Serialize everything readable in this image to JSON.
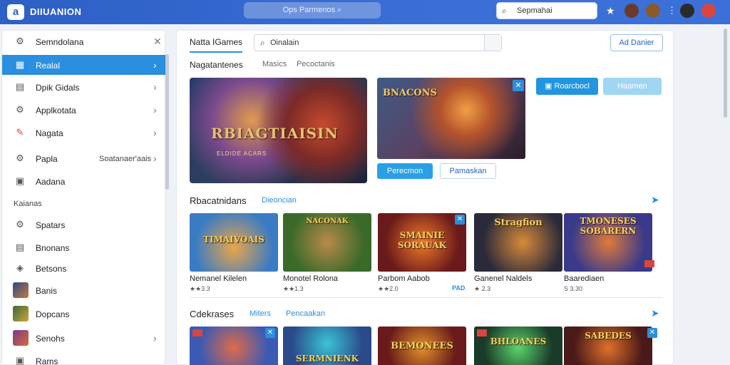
{
  "topbar": {
    "logo_letter": "a",
    "brand": "DIIUANION",
    "search_placeholder": "Ops Parmenos",
    "search2_text": "Sepmahai",
    "avatar_colors": [
      "#6b3a2a",
      "#8a5a2a",
      "#2b2b2b",
      "#c93b2f"
    ]
  },
  "sidebar": {
    "items": [
      {
        "icon": "gear-icon",
        "label": "Semndolana",
        "chevron": "✕"
      },
      {
        "icon": "calendar-icon",
        "label": "Realal",
        "chevron": "›",
        "active": true
      },
      {
        "icon": "document-icon",
        "label": "Dpik Gidals",
        "chevron": "›"
      },
      {
        "icon": "gear-icon",
        "label": "Applkotata",
        "chevron": "›"
      },
      {
        "icon": "pencil-icon",
        "label": "Nagata",
        "chevron": "›"
      },
      {
        "icon": "gear-icon",
        "label": "Papla",
        "extra": "Soatanaer'aais",
        "chevron": "›"
      },
      {
        "icon": "grid-icon",
        "label": "Aadana",
        "chevron": ""
      }
    ],
    "section_label": "Kaianas",
    "sub_items": [
      {
        "icon": "gear-icon",
        "label": "Spatars"
      },
      {
        "icon": "document-icon",
        "label": "Bnonans"
      },
      {
        "icon": "tag-icon",
        "label": "Betsons"
      },
      {
        "icon": "game-thumb-icon",
        "label": "Banis"
      },
      {
        "icon": "game-thumb-icon",
        "label": "Dopcans"
      },
      {
        "icon": "game-thumb-icon",
        "label": "Senohs",
        "chevron": "›"
      },
      {
        "icon": "grid-icon",
        "label": "Rams"
      }
    ]
  },
  "main": {
    "tab": "Natta IGames",
    "search_text": "Oinalain",
    "add_button": "Ad Danier",
    "subtabs": [
      "Nagatantenes",
      "Masics",
      "Pecoctanis"
    ],
    "hero1_title": "RBIAGTIAISIN",
    "hero1_subtitle": "ELDIDE ACARS",
    "hero2_title": "BNACONS",
    "hero2_primary": "Perecmon",
    "hero2_secondary": "Pamaskan",
    "top_primary": "Roarcbocl",
    "top_secondary": "Haamen",
    "section1": {
      "title": "Rbacatnidans",
      "link": "Dieoncian"
    },
    "cards1": [
      {
        "title": "TIMAIVOAIS",
        "name": "Nemanel Kilelen",
        "meta": "★★3.3"
      },
      {
        "title": "NACONAK",
        "name": "Monotel Rolona",
        "meta": "★★1.3"
      },
      {
        "title": "SMAINIE SORAUAK",
        "name": "Parbom Aabob",
        "meta": "★★2.0",
        "badge": "PAD"
      },
      {
        "title": "Stragfion",
        "name": "Ganenel Naldels",
        "meta": "★ 2.3"
      },
      {
        "title": "TMONESES SOBARERN",
        "name": "Baarediaen",
        "meta": "S 3.30"
      }
    ],
    "section2": {
      "title": "Cdekrases",
      "link1": "Miters",
      "link2": "Pencaakan"
    },
    "cards2": [
      {
        "title": ""
      },
      {
        "title": "SERMNIENK"
      },
      {
        "title": "BEMONEES"
      },
      {
        "title": "BHLOANES"
      },
      {
        "title": "SABEDES"
      }
    ]
  }
}
